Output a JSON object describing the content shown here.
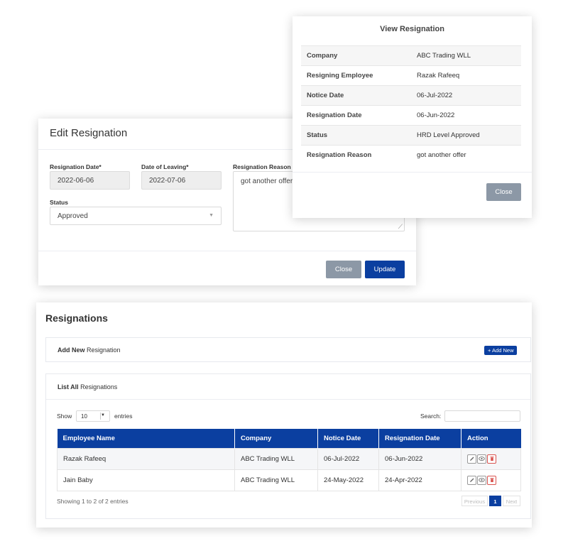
{
  "edit_modal": {
    "title": "Edit Resignation",
    "resignation_date_label": "Resignation Date*",
    "resignation_date_value": "2022-06-06",
    "leaving_date_label": "Date of Leaving*",
    "leaving_date_value": "2022-07-06",
    "reason_label": "Resignation Reason",
    "reason_value": "got another offer",
    "status_label": "Status",
    "status_value": "Approved",
    "close_label": "Close",
    "update_label": "Update"
  },
  "view_modal": {
    "title": "View Resignation",
    "rows": [
      {
        "key": "Company",
        "value": "ABC Trading WLL"
      },
      {
        "key": "Resigning Employee",
        "value": "Razak Rafeeq"
      },
      {
        "key": "Notice Date",
        "value": "06-Jul-2022"
      },
      {
        "key": "Resignation Date",
        "value": "06-Jun-2022"
      },
      {
        "key": "Status",
        "value": "HRD Level Approved"
      },
      {
        "key": "Resignation Reason",
        "value": "got another offer"
      }
    ],
    "close_label": "Close"
  },
  "main": {
    "title": "Resignations",
    "add_section": {
      "bold": "Add New",
      "rest": " Resignation",
      "button": "+ Add New"
    },
    "list_section": {
      "bold": "List All",
      "rest": " Resignations"
    },
    "show_label": "Show",
    "page_length": "10",
    "entries_label": "entries",
    "search_label": "Search:",
    "table": {
      "headers": [
        "Employee Name",
        "Company",
        "Notice Date",
        "Resignation Date",
        "Action"
      ],
      "rows": [
        [
          "Razak Rafeeq",
          "ABC Trading WLL",
          "06-Jul-2022",
          "06-Jun-2022"
        ],
        [
          "Jain Baby",
          "ABC Trading WLL",
          "24-May-2022",
          "24-Apr-2022"
        ]
      ]
    },
    "info": "Showing 1 to 2 of 2 entries",
    "pagination": {
      "previous": "Previous",
      "page": "1",
      "next": "Next"
    }
  },
  "colors": {
    "primary": "#0b3fa0",
    "secondary_button": "#8c98a6",
    "delete": "#d9534f"
  },
  "icons": {
    "edit": "pencil-icon",
    "view": "eye-icon",
    "delete": "trash-icon"
  }
}
